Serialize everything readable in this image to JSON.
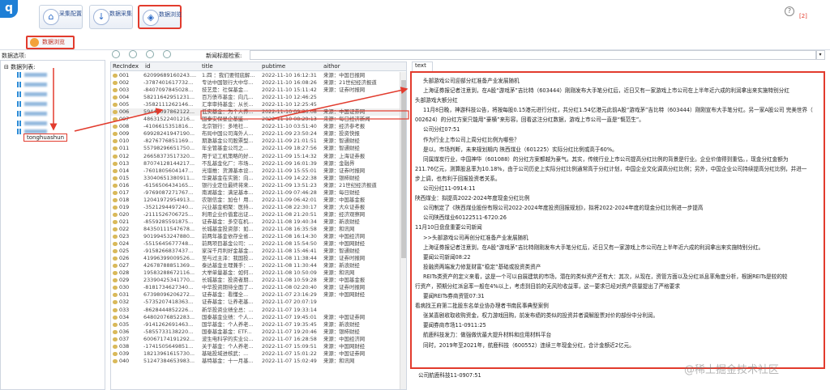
{
  "app": {
    "logo_letter": "q",
    "title_faint": ""
  },
  "toolbar": {
    "btn1": {
      "icon": "home-icon",
      "label": "采集配置"
    },
    "btn2": {
      "icon": "download-icon",
      "label": "数据采集"
    },
    "btn3": {
      "icon": "layers-icon",
      "label": "数据浏览"
    },
    "help_icon": "help-circle-icon",
    "page_num": "[2]"
  },
  "subbar": {
    "browse_label": "数据浏览"
  },
  "left_panel": {
    "title": "数据选项:",
    "root_label": "数据列表:",
    "tonghuashun_label": "tonghuashun"
  },
  "search": {
    "label": "新闻标题检索:",
    "value": ""
  },
  "grid": {
    "headers": [
      "RecIndex",
      "id",
      "title",
      "pubtime",
      "aithor"
    ],
    "rows": [
      [
        "001",
        "62099689160243....",
        "1.四 ：我们要彻底解...",
        "2022-11-10 16:12:31",
        "来源：中国日报网"
      ],
      [
        "002",
        "-3787401617732...",
        "专访中国银行大中华...",
        "2022-11-10 16:08:26",
        "来源：21世纪经济报道"
      ],
      [
        "003",
        "-8407097845028...",
        "技艺是：社保基金...",
        "2022-11-10 15:11:42",
        "来源：证券时报网"
      ],
      [
        "004",
        "58211642951231...",
        "百万债市基金：向几...",
        "2022-11-10 12:46:25",
        ""
      ],
      [
        "005",
        "-3582111262146...",
        "汇率审持基金：从长...",
        "2022-11-10 12:25:45",
        ""
      ],
      [
        "006",
        "59441097862122...",
        "低实基金：为个人养...",
        "2022-11-10 09:36:08",
        "来源：中国证券网"
      ],
      [
        "007",
        "48631522401216...",
        "国泰安保星企基监...",
        "2022-11-10 08:29:13",
        "来源：每日经济新闻"
      ],
      [
        "008",
        "-4106615351816...",
        "北京银行：多地社...",
        "2022-11-10 03:51:40",
        "来源：经济参考报"
      ],
      [
        "009",
        "69928241947190...",
        "布局中国公司海外人...",
        "2022-11-09 23:50:24",
        "来源：投资快报"
      ],
      [
        "010",
        "-8276776851169...",
        "期激基金公司股票型...",
        "2022-11-09 21:01:51",
        "来源：智通财经"
      ],
      [
        "011",
        "55798296651750...",
        "年全管基金公司之...",
        "2022-11-09 18:27:56",
        "来源：智通财经"
      ],
      [
        "012",
        "26658373517320...",
        "用于证工机策略的好...",
        "2022-11-09 15:14:32",
        "来源：上海证券报"
      ],
      [
        "013",
        "87074128144217...",
        "不乱基金化厂：市场...",
        "2022-11-09 16:01:39",
        "来源：金融界"
      ],
      [
        "014",
        "-7601805604147...",
        "光谱推：货源基本设...",
        "2022-11-09 15:55:01",
        "来源：证券时报网"
      ],
      [
        "015",
        "33040651380911...",
        "华夏基金在实施：向...",
        "2022-11-09 14:22:38",
        "来源：银柿财经"
      ],
      [
        "016",
        "-6156506434165...",
        "银行业定位最终将来...",
        "2022-11-09 13:51:23",
        "来源：21世纪经济报道"
      ],
      [
        "017",
        "-9769087271767...",
        "南湖基金：满足基本...",
        "2022-11-09 07:46:28",
        "来源：每日财经"
      ],
      [
        "018",
        "12041972954913...",
        "农银信金：加仓！用...",
        "2022-11-09 06:42:01",
        "来源：中国基金报"
      ],
      [
        "019",
        "-3521294497240...",
        "兴业基金相聚：医持...",
        "2022-11-08 22:30:17",
        "来源：大众证券报"
      ],
      [
        "020",
        "-2111526706725...",
        "利用企业价值套出证...",
        "2022-11-08 21:20:51",
        "来源：经济观察网"
      ],
      [
        "021",
        "-8559285591875...",
        "证券基金：多空在机...",
        "2022-11-08 19:40:34",
        "来源：新浪财经"
      ],
      [
        "022",
        "84350111547678...",
        "长城基金投资部：如...",
        "2022-11-08 16:35:58",
        "来源：和讯网"
      ],
      [
        "023",
        "90199453247880...",
        "前两年基金依存全省...",
        "2022-11-08 16:14:30",
        "来源：中国经济网"
      ],
      [
        "024",
        "-5515645677748...",
        "前两项目基金公司：...",
        "2022-11-08 15:54:50",
        "来源：中国网财经"
      ],
      [
        "025",
        "-9158266837437...",
        "家深千月利好金基金...",
        "2022-11-08 15:46:41",
        "来源：智通财经"
      ],
      [
        "026",
        "41996399009526...",
        "至与过主泽：我国投...",
        "2022-11-08 11:38:44",
        "来源：证券时报网"
      ],
      [
        "027",
        "42678788851369...",
        "泰达基金主理兼手：...",
        "2022-11-08 11:30:44",
        "来源：新浪财经"
      ],
      [
        "028",
        "19583288672116...",
        "大举单量基金：如何...",
        "2022-11-08 10:50:09",
        "来源：和讯网"
      ],
      [
        "029",
        "23390425341770...",
        "长城基金：投资者期...",
        "2022-11-08 10:59:28",
        "来源：中国基金报"
      ],
      [
        "030",
        "-8181734627340...",
        "中华投资期待全面了...",
        "2022-11-08 02:20:40",
        "来源：证券时报网"
      ],
      [
        "031",
        "67398096206272...",
        "证券基金：看懂全...",
        "2022-11-07 23:16:29",
        "来源：中国网财经"
      ],
      [
        "032",
        "-5735207418363...",
        "证券基金：让养老基...",
        "2022-11-07 20:07:19",
        ""
      ],
      [
        "033",
        "-8628444852226...",
        "新华投资业绩全总：...",
        "2022-11-07 19:33:14",
        ""
      ],
      [
        "034",
        "64802076852283...",
        "国泰基金业绩：个人...",
        "2022-11-07 19:45:01",
        "来源：中国证券网"
      ],
      [
        "035",
        "-9141262691463...",
        "国华基金：个人养老...",
        "2022-11-07 19:35:45",
        "来源：新浪财经"
      ],
      [
        "036",
        "-5855733138220...",
        "国泰基金基金：ETF...",
        "2022-11-07 19:20:46",
        "来源：银柿财经"
      ],
      [
        "037",
        "60067174191292...",
        "波生电科学的实业公...",
        "2022-11-07 16:28:58",
        "来源：中国经济网"
      ],
      [
        "038",
        "-1741505649851...",
        "关于基金：个人养老...",
        "2022-11-07 15:09:51",
        "来源：中国网财经"
      ],
      [
        "039",
        "18213961615730...",
        "基础投域进核武：...",
        "2022-11-07 15:01:22",
        "来源：中国证券网"
      ],
      [
        "040",
        "51247384653983...",
        "基特基金：十一月基...",
        "2022-11-07 15:02:49",
        "来源：和讯网"
      ]
    ]
  },
  "doc": {
    "tab_label": "text",
    "lines": [
      {
        "t": "头部游戏公司迎部分红准备产业发展随机",
        "ind": true
      },
      {
        "t": "上海证券报记者注意到，在A股“游戏茅”吉比特（603444）刚刚发布大手笔分红后，近日又有一家游戏上市公司在上半年近六成的利润拿出来实施特别分红",
        "ind": true
      },
      {
        "t": "头部游戏大额分红",
        "ind": false
      },
      {
        "t": "11月8日晚，神游科技公告，将按每股0.15港元进行分红，共分红1.54亿港元此前A股“游戏茅”吉比特（603444）刚刚宣布大手笔分红。另一家A股公司 完美世界（",
        "ind": true
      },
      {
        "t": "002624）的分红方案只能用“豪横”来形容。回看这注分红数据，游戏上市公司一直是“慨范生”。",
        "ind": false
      },
      {
        "t": "公司分红07:51",
        "ind": true
      },
      {
        "t": "作为行业上市公司上周分红比例为哪些？",
        "ind": true
      },
      {
        "t": "是以，市场判断，未来规划期内 陕西煤业（601225）实际分红比例或高于60%。",
        "ind": true
      },
      {
        "t": "同属煤炭行业，中国神华（601088）的分红方案都越为豪气。其实，传统行业上市公司提高分红比例的背景是行业。企业价值得到重估。，现金分红金额为",
        "ind": true
      },
      {
        "t": "211.76亿元，测算股息率为10.18%，由于公司历史上实际分红比例通常高于分红计划，中国企业文化调高分红比例；另外，中国企业公司持续提高分红比例，并进一",
        "ind": false
      },
      {
        "t": "步上调，也有利于回报投资者关系。",
        "ind": false
      },
      {
        "t": "公司分红11-0914:11",
        "ind": true
      },
      {
        "t": "陕西煤业：拟提高2022-2024年度现金分红比例",
        "ind": false
      },
      {
        "t": "公司制定了《陕西煤业股份有限公司2022-2024年度投资回报规划》，拟将2022-2024年度的现金分红比例进一步提高",
        "ind": true
      },
      {
        "t": "公司陕西煤业60122511-6720:26",
        "ind": true
      },
      {
        "t": "11月10日盘盘重要公司新闻",
        "ind": false
      },
      {
        "t": ">>头部游戏公司再创分红准备产业发展随机",
        "ind": true
      },
      {
        "t": "上海证券报记者注意到，在A股“游戏茅”吉比特刚刚发布大手笔分红后，近日又有一家游戏上市公司在上半年近六成的利润拿出来实施特别分红。",
        "ind": true
      },
      {
        "t": "要闻公司新闻08:22",
        "ind": true
      },
      {
        "t": "投融资两端发力修复财富“稳定”基础或投资类资产",
        "ind": true
      },
      {
        "t": "REITs类资产的定义来看，这是一个可以自展建筑的市场，潜在的类似资产还有大：其次，从现在，资管方面以及分红派息率角度分析，根据REITs是较的较",
        "ind": true
      },
      {
        "t": "行资产，预期分红派息率一般在4%以上，考虑到目前的无风险收益率，这一要求已经对资产质量提出了严格要求",
        "ind": false
      },
      {
        "t": "要闻REITs券商资管07:31",
        "ind": true
      },
      {
        "t": "看病找王府第二批股东名单业协办理者书南民事典型案例",
        "ind": false
      },
      {
        "t": "张某喜剧收取收购资金，权力游戏回购，前发布绩的类似的投资并者调解股票对价的部份中分利润。",
        "ind": true
      },
      {
        "t": "要闻券商市场11-0911:25",
        "ind": true
      },
      {
        "t": "航鹿科技发力：做强做优最大提升材料和应用材料平台",
        "ind": true
      },
      {
        "t": "同时，2019年至2021年，航鹿科技（600552）连续三年现金分红，合计金额近2亿元。",
        "ind": true
      }
    ],
    "tail": "公司航鹿科技11-0907:51",
    "watermark": "@稀土掘金技术社区"
  },
  "colors": {
    "highlight": "#e23b2d",
    "accent": "#1e7fd6"
  }
}
